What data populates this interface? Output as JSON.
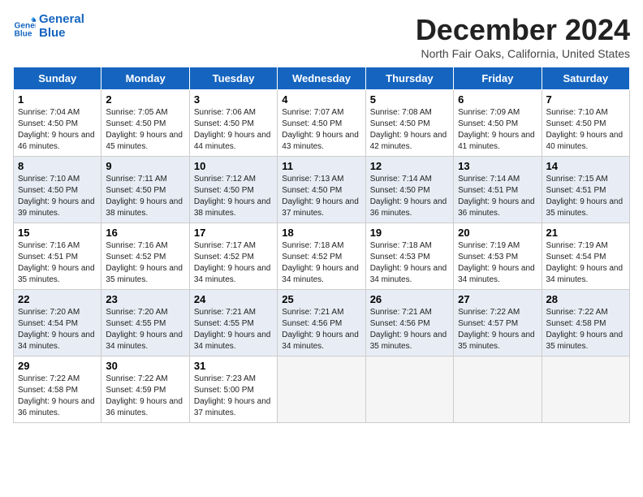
{
  "logo": {
    "line1": "General",
    "line2": "Blue"
  },
  "title": "December 2024",
  "subtitle": "North Fair Oaks, California, United States",
  "weekdays": [
    "Sunday",
    "Monday",
    "Tuesday",
    "Wednesday",
    "Thursday",
    "Friday",
    "Saturday"
  ],
  "weeks": [
    [
      {
        "day": "1",
        "sunrise": "Sunrise: 7:04 AM",
        "sunset": "Sunset: 4:50 PM",
        "daylight": "Daylight: 9 hours and 46 minutes."
      },
      {
        "day": "2",
        "sunrise": "Sunrise: 7:05 AM",
        "sunset": "Sunset: 4:50 PM",
        "daylight": "Daylight: 9 hours and 45 minutes."
      },
      {
        "day": "3",
        "sunrise": "Sunrise: 7:06 AM",
        "sunset": "Sunset: 4:50 PM",
        "daylight": "Daylight: 9 hours and 44 minutes."
      },
      {
        "day": "4",
        "sunrise": "Sunrise: 7:07 AM",
        "sunset": "Sunset: 4:50 PM",
        "daylight": "Daylight: 9 hours and 43 minutes."
      },
      {
        "day": "5",
        "sunrise": "Sunrise: 7:08 AM",
        "sunset": "Sunset: 4:50 PM",
        "daylight": "Daylight: 9 hours and 42 minutes."
      },
      {
        "day": "6",
        "sunrise": "Sunrise: 7:09 AM",
        "sunset": "Sunset: 4:50 PM",
        "daylight": "Daylight: 9 hours and 41 minutes."
      },
      {
        "day": "7",
        "sunrise": "Sunrise: 7:10 AM",
        "sunset": "Sunset: 4:50 PM",
        "daylight": "Daylight: 9 hours and 40 minutes."
      }
    ],
    [
      {
        "day": "8",
        "sunrise": "Sunrise: 7:10 AM",
        "sunset": "Sunset: 4:50 PM",
        "daylight": "Daylight: 9 hours and 39 minutes."
      },
      {
        "day": "9",
        "sunrise": "Sunrise: 7:11 AM",
        "sunset": "Sunset: 4:50 PM",
        "daylight": "Daylight: 9 hours and 38 minutes."
      },
      {
        "day": "10",
        "sunrise": "Sunrise: 7:12 AM",
        "sunset": "Sunset: 4:50 PM",
        "daylight": "Daylight: 9 hours and 38 minutes."
      },
      {
        "day": "11",
        "sunrise": "Sunrise: 7:13 AM",
        "sunset": "Sunset: 4:50 PM",
        "daylight": "Daylight: 9 hours and 37 minutes."
      },
      {
        "day": "12",
        "sunrise": "Sunrise: 7:14 AM",
        "sunset": "Sunset: 4:50 PM",
        "daylight": "Daylight: 9 hours and 36 minutes."
      },
      {
        "day": "13",
        "sunrise": "Sunrise: 7:14 AM",
        "sunset": "Sunset: 4:51 PM",
        "daylight": "Daylight: 9 hours and 36 minutes."
      },
      {
        "day": "14",
        "sunrise": "Sunrise: 7:15 AM",
        "sunset": "Sunset: 4:51 PM",
        "daylight": "Daylight: 9 hours and 35 minutes."
      }
    ],
    [
      {
        "day": "15",
        "sunrise": "Sunrise: 7:16 AM",
        "sunset": "Sunset: 4:51 PM",
        "daylight": "Daylight: 9 hours and 35 minutes."
      },
      {
        "day": "16",
        "sunrise": "Sunrise: 7:16 AM",
        "sunset": "Sunset: 4:52 PM",
        "daylight": "Daylight: 9 hours and 35 minutes."
      },
      {
        "day": "17",
        "sunrise": "Sunrise: 7:17 AM",
        "sunset": "Sunset: 4:52 PM",
        "daylight": "Daylight: 9 hours and 34 minutes."
      },
      {
        "day": "18",
        "sunrise": "Sunrise: 7:18 AM",
        "sunset": "Sunset: 4:52 PM",
        "daylight": "Daylight: 9 hours and 34 minutes."
      },
      {
        "day": "19",
        "sunrise": "Sunrise: 7:18 AM",
        "sunset": "Sunset: 4:53 PM",
        "daylight": "Daylight: 9 hours and 34 minutes."
      },
      {
        "day": "20",
        "sunrise": "Sunrise: 7:19 AM",
        "sunset": "Sunset: 4:53 PM",
        "daylight": "Daylight: 9 hours and 34 minutes."
      },
      {
        "day": "21",
        "sunrise": "Sunrise: 7:19 AM",
        "sunset": "Sunset: 4:54 PM",
        "daylight": "Daylight: 9 hours and 34 minutes."
      }
    ],
    [
      {
        "day": "22",
        "sunrise": "Sunrise: 7:20 AM",
        "sunset": "Sunset: 4:54 PM",
        "daylight": "Daylight: 9 hours and 34 minutes."
      },
      {
        "day": "23",
        "sunrise": "Sunrise: 7:20 AM",
        "sunset": "Sunset: 4:55 PM",
        "daylight": "Daylight: 9 hours and 34 minutes."
      },
      {
        "day": "24",
        "sunrise": "Sunrise: 7:21 AM",
        "sunset": "Sunset: 4:55 PM",
        "daylight": "Daylight: 9 hours and 34 minutes."
      },
      {
        "day": "25",
        "sunrise": "Sunrise: 7:21 AM",
        "sunset": "Sunset: 4:56 PM",
        "daylight": "Daylight: 9 hours and 34 minutes."
      },
      {
        "day": "26",
        "sunrise": "Sunrise: 7:21 AM",
        "sunset": "Sunset: 4:56 PM",
        "daylight": "Daylight: 9 hours and 35 minutes."
      },
      {
        "day": "27",
        "sunrise": "Sunrise: 7:22 AM",
        "sunset": "Sunset: 4:57 PM",
        "daylight": "Daylight: 9 hours and 35 minutes."
      },
      {
        "day": "28",
        "sunrise": "Sunrise: 7:22 AM",
        "sunset": "Sunset: 4:58 PM",
        "daylight": "Daylight: 9 hours and 35 minutes."
      }
    ],
    [
      {
        "day": "29",
        "sunrise": "Sunrise: 7:22 AM",
        "sunset": "Sunset: 4:58 PM",
        "daylight": "Daylight: 9 hours and 36 minutes."
      },
      {
        "day": "30",
        "sunrise": "Sunrise: 7:22 AM",
        "sunset": "Sunset: 4:59 PM",
        "daylight": "Daylight: 9 hours and 36 minutes."
      },
      {
        "day": "31",
        "sunrise": "Sunrise: 7:23 AM",
        "sunset": "Sunset: 5:00 PM",
        "daylight": "Daylight: 9 hours and 37 minutes."
      },
      null,
      null,
      null,
      null
    ]
  ]
}
